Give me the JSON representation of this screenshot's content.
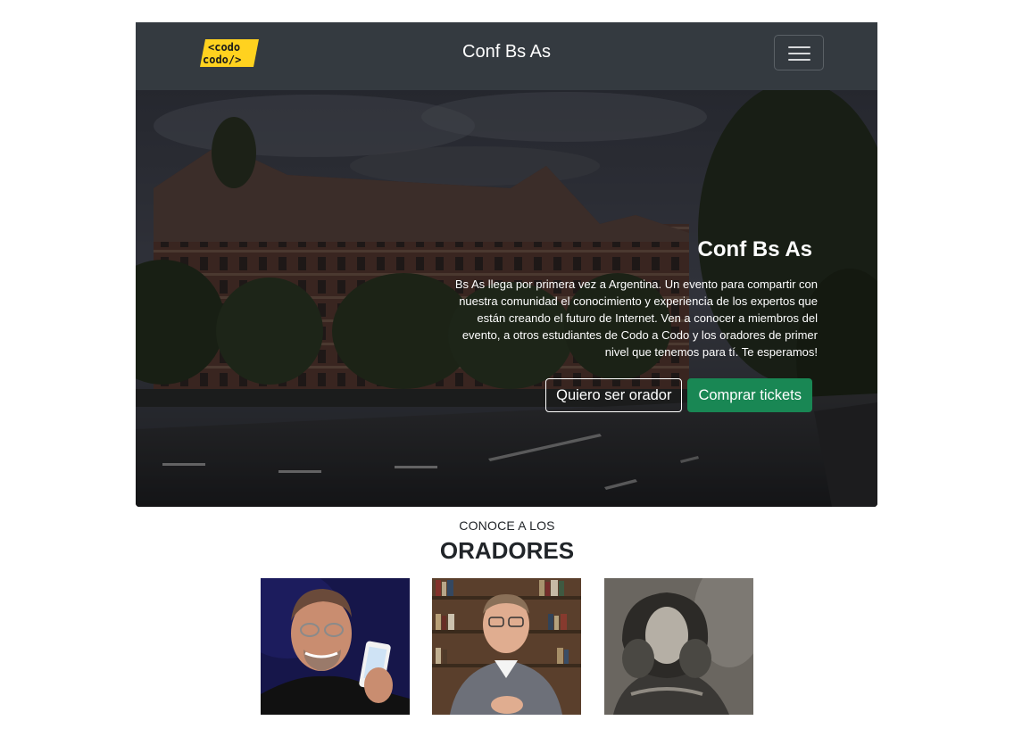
{
  "navbar": {
    "logo_line1": "<codo",
    "logo_line2": "codo/>",
    "title": "Conf Bs As",
    "menu_button_label": "menu-icon"
  },
  "hero": {
    "title": "Conf Bs As",
    "description": "Bs As llega por primera vez a Argentina. Un evento para compartir con nuestra comunidad el conocimiento y experiencia de los expertos que están creando el futuro de Internet. Ven a conocer a miembros del evento, a otros estudiantes de Codo a Codo y los oradores de primer nivel que tenemos para tí. Te esperamos!",
    "button_speaker": "Quiero ser orador",
    "button_tickets": "Comprar tickets"
  },
  "speakers": {
    "pretitle": "CONOCE A LOS",
    "title": "ORADORES",
    "photos": [
      "photo-speaker-1",
      "photo-speaker-2",
      "photo-speaker-3"
    ]
  },
  "colors": {
    "navbar": "#343a40",
    "success": "#198754",
    "logo_yellow": "#ffd21f"
  }
}
